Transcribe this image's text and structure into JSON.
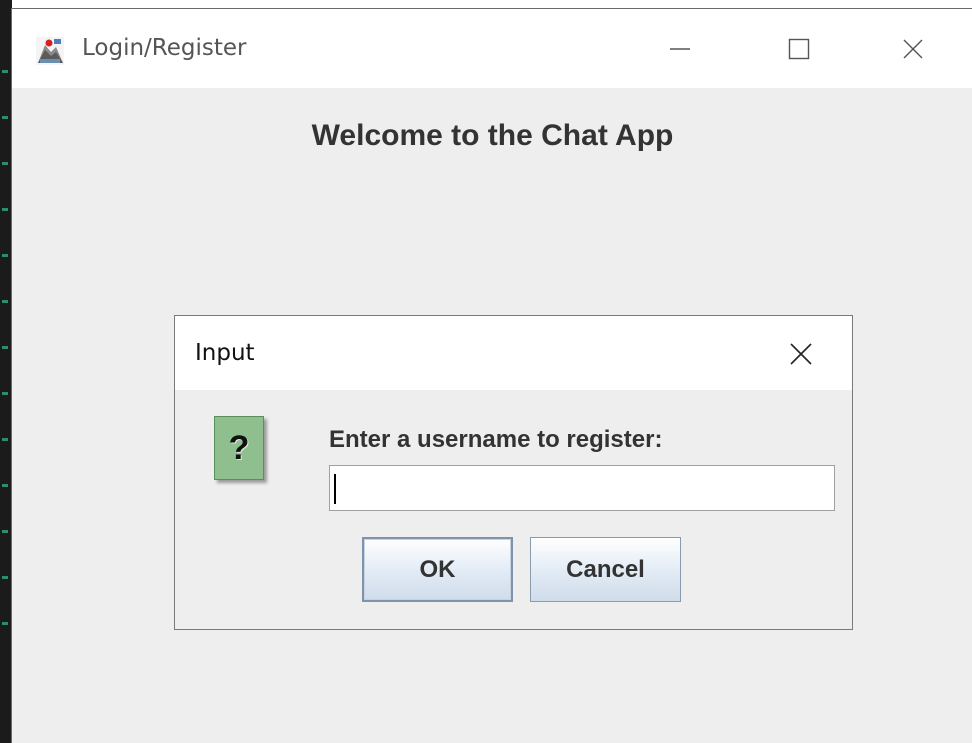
{
  "window": {
    "title": "Login/Register",
    "controls": [
      "minimize",
      "maximize",
      "close"
    ]
  },
  "main": {
    "heading": "Welcome to the Chat App"
  },
  "dialog": {
    "title": "Input",
    "icon": "question-icon",
    "icon_glyph": "?",
    "prompt": "Enter a username to register:",
    "input_value": "",
    "ok_label": "OK",
    "cancel_label": "Cancel"
  },
  "colors": {
    "window_bg": "#eeeeee",
    "titlebar_bg": "#ffffff",
    "question_icon_bg": "#8fbf8f"
  }
}
